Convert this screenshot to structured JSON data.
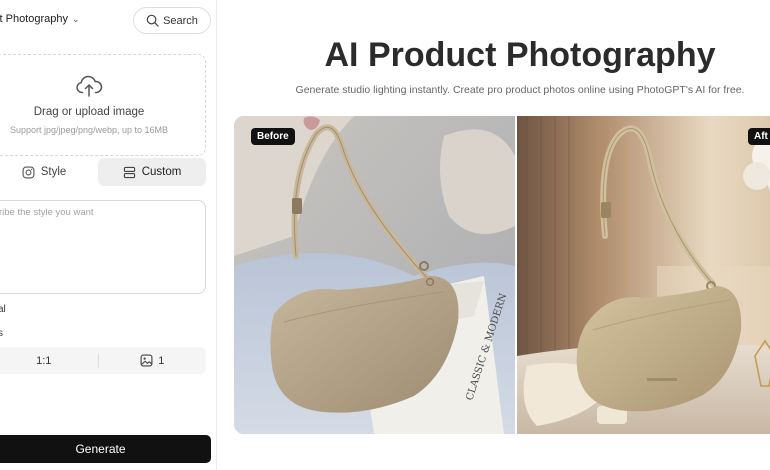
{
  "sidebar": {
    "tool_select": "ct Photography",
    "search_label": "Search",
    "upload": {
      "title": "Drag or upload image",
      "subtitle": "Support jpg/jpeg/png/webp, up to 16MB"
    },
    "tabs": [
      {
        "label": "Style",
        "icon": "instagram-icon",
        "active": false
      },
      {
        "label": "Custom",
        "icon": "custom-layout-icon",
        "active": true
      }
    ],
    "prompt_placeholder": "ribe the style you want",
    "label_a": "al",
    "label_b": "s",
    "options": {
      "ratio": "1:1",
      "count": "1"
    },
    "generate_label": "Generate"
  },
  "main": {
    "title": "AI Product Photography",
    "subtitle": "Generate studio lighting instantly. Create pro product photos online using PhotoGPT's AI for free.",
    "before_label": "Before",
    "after_label": "Aft",
    "bag_text": "CLASSIC & MODERN"
  },
  "colors": {
    "accent": "#111111",
    "bag": "#b8a88e",
    "bag_after": "#c4b493"
  }
}
